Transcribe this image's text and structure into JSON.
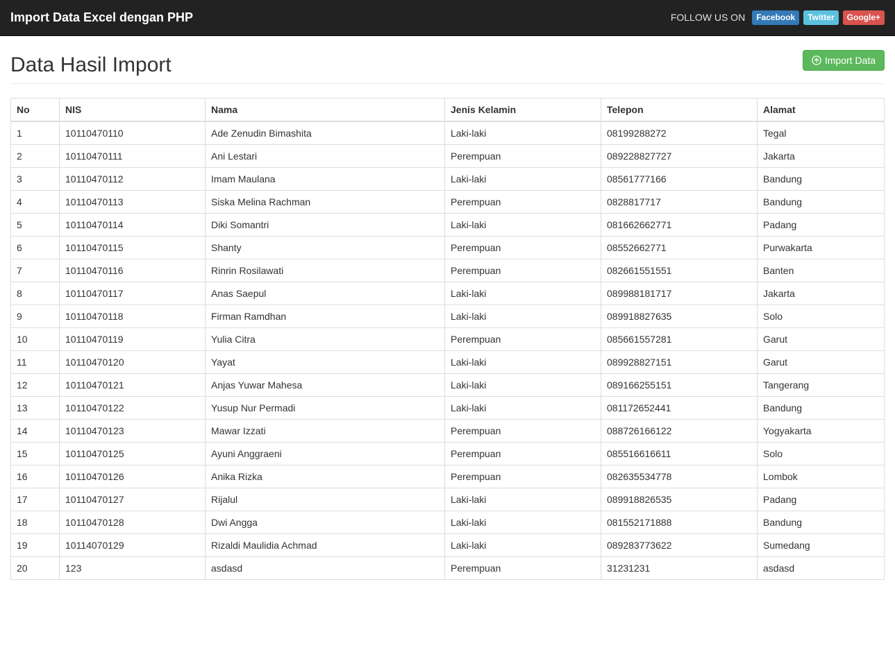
{
  "navbar": {
    "brand": "Import Data Excel dengan PHP",
    "follow_text": "FOLLOW US ON",
    "social": {
      "facebook": "Facebook",
      "twitter": "Twitter",
      "google": "Google+"
    }
  },
  "page": {
    "title": "Data Hasil Import",
    "import_btn": "Import Data"
  },
  "table": {
    "headers": {
      "no": "No",
      "nis": "NIS",
      "nama": "Nama",
      "jk": "Jenis Kelamin",
      "telepon": "Telepon",
      "alamat": "Alamat"
    },
    "rows": [
      {
        "no": "1",
        "nis": "10110470110",
        "nama": "Ade Zenudin Bimashita",
        "jk": "Laki-laki",
        "telepon": "08199288272",
        "alamat": "Tegal"
      },
      {
        "no": "2",
        "nis": "10110470111",
        "nama": "Ani Lestari",
        "jk": "Perempuan",
        "telepon": "089228827727",
        "alamat": "Jakarta"
      },
      {
        "no": "3",
        "nis": "10110470112",
        "nama": "Imam Maulana",
        "jk": "Laki-laki",
        "telepon": "08561777166",
        "alamat": "Bandung"
      },
      {
        "no": "4",
        "nis": "10110470113",
        "nama": "Siska Melina Rachman",
        "jk": "Perempuan",
        "telepon": "0828817717",
        "alamat": "Bandung"
      },
      {
        "no": "5",
        "nis": "10110470114",
        "nama": "Diki Somantri",
        "jk": "Laki-laki",
        "telepon": "081662662771",
        "alamat": "Padang"
      },
      {
        "no": "6",
        "nis": "10110470115",
        "nama": "Shanty",
        "jk": "Perempuan",
        "telepon": "08552662771",
        "alamat": "Purwakarta"
      },
      {
        "no": "7",
        "nis": "10110470116",
        "nama": "Rinrin Rosilawati",
        "jk": "Perempuan",
        "telepon": "082661551551",
        "alamat": "Banten"
      },
      {
        "no": "8",
        "nis": "10110470117",
        "nama": "Anas Saepul",
        "jk": "Laki-laki",
        "telepon": "089988181717",
        "alamat": "Jakarta"
      },
      {
        "no": "9",
        "nis": "10110470118",
        "nama": "Firman Ramdhan",
        "jk": "Laki-laki",
        "telepon": "089918827635",
        "alamat": "Solo"
      },
      {
        "no": "10",
        "nis": "10110470119",
        "nama": "Yulia Citra",
        "jk": "Perempuan",
        "telepon": "085661557281",
        "alamat": "Garut"
      },
      {
        "no": "11",
        "nis": "10110470120",
        "nama": "Yayat",
        "jk": "Laki-laki",
        "telepon": "089928827151",
        "alamat": "Garut"
      },
      {
        "no": "12",
        "nis": "10110470121",
        "nama": "Anjas Yuwar Mahesa",
        "jk": "Laki-laki",
        "telepon": "089166255151",
        "alamat": "Tangerang"
      },
      {
        "no": "13",
        "nis": "10110470122",
        "nama": "Yusup Nur Permadi",
        "jk": "Laki-laki",
        "telepon": "081172652441",
        "alamat": "Bandung"
      },
      {
        "no": "14",
        "nis": "10110470123",
        "nama": "Mawar Izzati",
        "jk": "Perempuan",
        "telepon": "088726166122",
        "alamat": "Yogyakarta"
      },
      {
        "no": "15",
        "nis": "10110470125",
        "nama": "Ayuni Anggraeni",
        "jk": "Perempuan",
        "telepon": "085516616611",
        "alamat": "Solo"
      },
      {
        "no": "16",
        "nis": "10110470126",
        "nama": "Anika Rizka",
        "jk": "Perempuan",
        "telepon": "082635534778",
        "alamat": "Lombok"
      },
      {
        "no": "17",
        "nis": "10110470127",
        "nama": "Rijalul",
        "jk": "Laki-laki",
        "telepon": "089918826535",
        "alamat": "Padang"
      },
      {
        "no": "18",
        "nis": "10110470128",
        "nama": "Dwi Angga",
        "jk": "Laki-laki",
        "telepon": "081552171888",
        "alamat": "Bandung"
      },
      {
        "no": "19",
        "nis": "10114070129",
        "nama": "Rizaldi Maulidia Achmad",
        "jk": "Laki-laki",
        "telepon": "089283773622",
        "alamat": "Sumedang"
      },
      {
        "no": "20",
        "nis": "123",
        "nama": "asdasd",
        "jk": "Perempuan",
        "telepon": "31231231",
        "alamat": "asdasd"
      }
    ]
  }
}
